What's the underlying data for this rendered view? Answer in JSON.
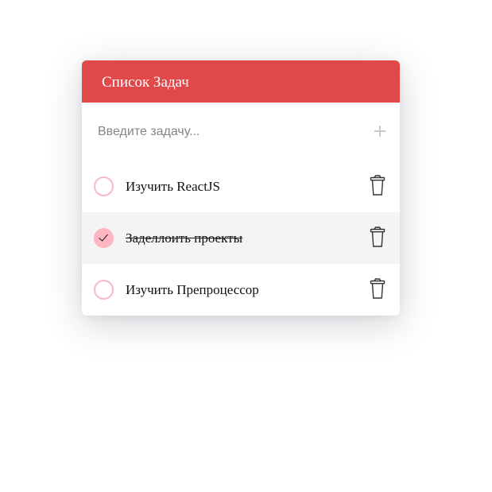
{
  "header": {
    "title": "Список Задач"
  },
  "add_task": {
    "placeholder": "Введите задачу...",
    "value": "",
    "add_icon": "plus-icon"
  },
  "tasks": [
    {
      "text": "Изучить ReactJS",
      "done": false,
      "delete_icon": "trash-icon"
    },
    {
      "text": "Заделлоить проекты",
      "done": true,
      "delete_icon": "trash-icon"
    },
    {
      "text": "Изучить Препроцессор",
      "done": false,
      "delete_icon": "trash-icon"
    }
  ],
  "colors": {
    "header_background": "#e14849",
    "checkbox_border": "#f8b9c5",
    "checkbox_checked": "#ffb5c2",
    "done_row_background": "#f4f4f4"
  }
}
